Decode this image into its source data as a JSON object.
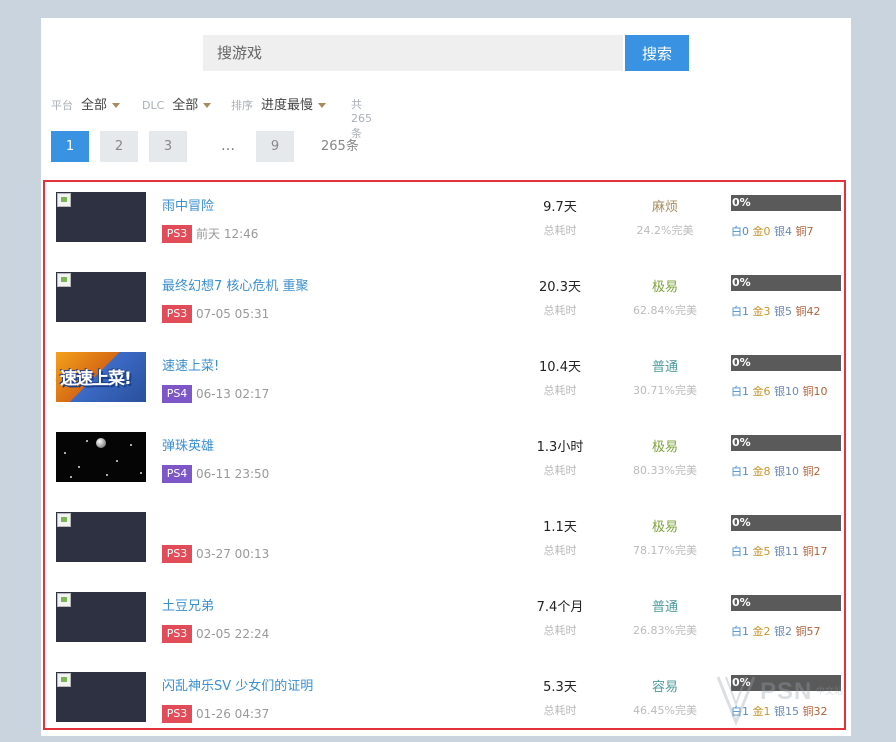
{
  "search": {
    "placeholder": "搜游戏",
    "button_label": "搜索"
  },
  "filters": {
    "platform": {
      "label": "平台",
      "value": "全部"
    },
    "dlc": {
      "label": "DLC",
      "value": "全部"
    },
    "sort": {
      "label": "排序",
      "value": "进度最慢"
    },
    "total": "共265条"
  },
  "pagination": {
    "pages": [
      "1",
      "2",
      "3",
      "9"
    ],
    "ellipsis": "…",
    "active": "1",
    "total": "265条"
  },
  "colors": {
    "accent": "#3a93e2",
    "ps3": "#e24b58",
    "ps4": "#7d56c7",
    "highlight_border": "#e0333a"
  },
  "labels": {
    "duration": "总耗时",
    "plat": "白",
    "gold": "金",
    "silver": "银",
    "bronze": "铜"
  },
  "games": [
    {
      "title": "雨中冒险",
      "platform": "PS3",
      "time": "前天 12:46",
      "duration": "9.7天",
      "difficulty": "麻烦",
      "completion": "24.2%完美",
      "progress": "0%",
      "progress_value": 0,
      "trophies": {
        "plat": "0",
        "gold": "0",
        "silver": "4",
        "bronze": "7"
      }
    },
    {
      "title": "最终幻想7 核心危机 重聚",
      "platform": "PS3",
      "time": "07-05 05:31",
      "duration": "20.3天",
      "difficulty": "极易",
      "completion": "62.84%完美",
      "progress": "0%",
      "progress_value": 0,
      "trophies": {
        "plat": "1",
        "gold": "3",
        "silver": "5",
        "bronze": "42"
      }
    },
    {
      "title": "速速上菜!",
      "platform": "PS4",
      "time": "06-13 02:17",
      "duration": "10.4天",
      "difficulty": "普通",
      "completion": "30.71%完美",
      "progress": "0%",
      "progress_value": 0,
      "trophies": {
        "plat": "1",
        "gold": "6",
        "silver": "10",
        "bronze": "10"
      }
    },
    {
      "title": "弹珠英雄",
      "platform": "PS4",
      "time": "06-11 23:50",
      "duration": "1.3小时",
      "difficulty": "极易",
      "completion": "80.33%完美",
      "progress": "0%",
      "progress_value": 0,
      "trophies": {
        "plat": "1",
        "gold": "8",
        "silver": "10",
        "bronze": "2"
      }
    },
    {
      "title": "",
      "platform": "PS3",
      "time": "03-27 00:13",
      "duration": "1.1天",
      "difficulty": "极易",
      "completion": "78.17%完美",
      "progress": "0%",
      "progress_value": 0,
      "trophies": {
        "plat": "1",
        "gold": "5",
        "silver": "11",
        "bronze": "17"
      }
    },
    {
      "title": "土豆兄弟",
      "platform": "PS3",
      "time": "02-05 22:24",
      "duration": "7.4个月",
      "difficulty": "普通",
      "completion": "26.83%完美",
      "progress": "0%",
      "progress_value": 0,
      "trophies": {
        "plat": "1",
        "gold": "2",
        "silver": "2",
        "bronze": "57"
      }
    },
    {
      "title": "闪乱神乐SV 少女们的证明",
      "platform": "PS3",
      "time": "01-26 04:37",
      "duration": "5.3天",
      "difficulty": "容易",
      "completion": "46.45%完美",
      "progress": "0%",
      "progress_value": 0,
      "trophies": {
        "plat": "1",
        "gold": "1",
        "silver": "15",
        "bronze": "32"
      }
    }
  ],
  "thumb_art": {
    "game_3_text": "速速上菜!"
  },
  "watermark": {
    "text": "PSN",
    "sub": "中文站"
  }
}
